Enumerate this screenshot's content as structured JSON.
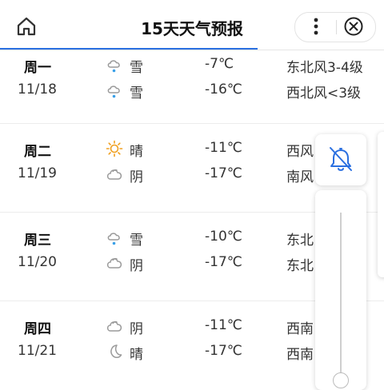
{
  "header": {
    "title": "15天天气预报",
    "icons": [
      "home-icon",
      "more-vertical-icon",
      "close-circle-icon"
    ]
  },
  "days": [
    {
      "weekday": "周一",
      "date": "11/18",
      "day": {
        "icon": "snow-icon",
        "text": "雪",
        "temp": "-7℃",
        "wind": "东北风3-4级"
      },
      "night": {
        "icon": "snow-icon",
        "text": "雪",
        "temp": "-16℃",
        "wind": "西北风<3级"
      }
    },
    {
      "weekday": "周二",
      "date": "11/19",
      "day": {
        "icon": "sun-icon",
        "text": "晴",
        "temp": "-11℃",
        "wind": "西风"
      },
      "night": {
        "icon": "cloud-icon",
        "text": "阴",
        "temp": "-17℃",
        "wind": "南风"
      }
    },
    {
      "weekday": "周三",
      "date": "11/20",
      "day": {
        "icon": "snow-icon",
        "text": "雪",
        "temp": "-10℃",
        "wind": "东北"
      },
      "night": {
        "icon": "cloud-icon",
        "text": "阴",
        "temp": "-17℃",
        "wind": "东北"
      }
    },
    {
      "weekday": "周四",
      "date": "11/21",
      "day": {
        "icon": "cloud-icon",
        "text": "阴",
        "temp": "-11℃",
        "wind": "西南"
      },
      "night": {
        "icon": "moon-icon",
        "text": "晴",
        "temp": "-17℃",
        "wind": "西南"
      }
    }
  ],
  "overlay": {
    "icons": [
      "bell-off-icon"
    ],
    "slider_value": 0.0
  },
  "colors": {
    "accent": "#2a6fe0",
    "sun": "#f0a020",
    "snow_dot": "#3aa0e8",
    "icon_gray": "#9a9a9a"
  }
}
